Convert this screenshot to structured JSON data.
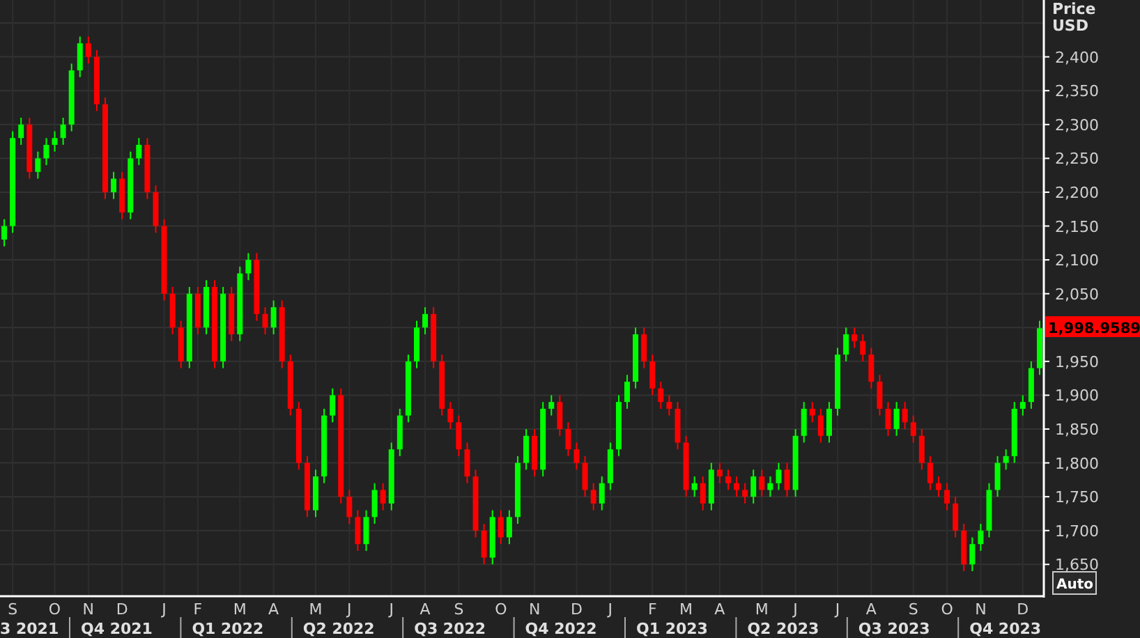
{
  "chart": {
    "price_axis": {
      "title": "Price",
      "unit": "USD"
    },
    "last_price": "1,998.9589",
    "scale_button": "Auto",
    "quarters": [
      "3 2021",
      "Q4 2021",
      "Q1 2022",
      "Q2 2022",
      "Q3 2022",
      "Q4 2022",
      "Q1 2023",
      "Q2 2023",
      "Q3 2023",
      "Q4 2023"
    ],
    "chart_data": {
      "type": "candlestick",
      "categories": [
        null,
        "S",
        null,
        null,
        null,
        null,
        "O",
        null,
        null,
        null,
        "N",
        null,
        null,
        null,
        "D",
        null,
        null,
        null,
        null,
        "J",
        null,
        null,
        null,
        "F",
        null,
        null,
        null,
        null,
        "M",
        null,
        null,
        null,
        "A",
        null,
        null,
        null,
        null,
        "M",
        null,
        null,
        null,
        "J",
        null,
        null,
        null,
        null,
        "J",
        null,
        null,
        null,
        "A",
        null,
        null,
        null,
        "S",
        null,
        null,
        null,
        null,
        "O",
        null,
        null,
        null,
        "N",
        null,
        null,
        null,
        null,
        "D",
        null,
        null,
        null,
        "J",
        null,
        null,
        null,
        null,
        "F",
        null,
        null,
        null,
        "M",
        null,
        null,
        null,
        "A",
        null,
        null,
        null,
        null,
        "M",
        null,
        null,
        null,
        "J",
        null,
        null,
        null,
        null,
        "J",
        null,
        null,
        null,
        "A",
        null,
        null,
        null,
        null,
        "S",
        null,
        null,
        null,
        "O",
        null,
        null,
        null,
        "N",
        null,
        null,
        null,
        null,
        "D",
        null,
        null
      ],
      "ohlc": [
        [
          2130,
          2160,
          2120,
          2150
        ],
        [
          2150,
          2290,
          2140,
          2280
        ],
        [
          2280,
          2310,
          2270,
          2300
        ],
        [
          2300,
          2310,
          2220,
          2230
        ],
        [
          2230,
          2260,
          2220,
          2250
        ],
        [
          2250,
          2280,
          2240,
          2270
        ],
        [
          2270,
          2290,
          2260,
          2280
        ],
        [
          2280,
          2310,
          2270,
          2300
        ],
        [
          2300,
          2390,
          2290,
          2380
        ],
        [
          2380,
          2430,
          2370,
          2420
        ],
        [
          2420,
          2430,
          2390,
          2400
        ],
        [
          2400,
          2410,
          2320,
          2330
        ],
        [
          2330,
          2340,
          2190,
          2200
        ],
        [
          2200,
          2230,
          2190,
          2220
        ],
        [
          2220,
          2230,
          2160,
          2170
        ],
        [
          2170,
          2260,
          2160,
          2250
        ],
        [
          2250,
          2280,
          2240,
          2270
        ],
        [
          2270,
          2280,
          2190,
          2200
        ],
        [
          2200,
          2210,
          2140,
          2150
        ],
        [
          2150,
          2160,
          2040,
          2050
        ],
        [
          2050,
          2060,
          1990,
          2000
        ],
        [
          2000,
          2010,
          1940,
          1950
        ],
        [
          1950,
          2060,
          1940,
          2050
        ],
        [
          2050,
          2060,
          1990,
          2000
        ],
        [
          2000,
          2070,
          1990,
          2060
        ],
        [
          2060,
          2070,
          1940,
          1950
        ],
        [
          1950,
          2060,
          1940,
          2050
        ],
        [
          2050,
          2060,
          1980,
          1990
        ],
        [
          1990,
          2090,
          1980,
          2080
        ],
        [
          2080,
          2110,
          2070,
          2100
        ],
        [
          2100,
          2110,
          2010,
          2020
        ],
        [
          2020,
          2030,
          1990,
          2000
        ],
        [
          2000,
          2040,
          1990,
          2030
        ],
        [
          2030,
          2040,
          1940,
          1950
        ],
        [
          1950,
          1960,
          1870,
          1880
        ],
        [
          1880,
          1890,
          1790,
          1800
        ],
        [
          1800,
          1810,
          1720,
          1730
        ],
        [
          1730,
          1790,
          1720,
          1780
        ],
        [
          1780,
          1880,
          1770,
          1870
        ],
        [
          1870,
          1910,
          1860,
          1900
        ],
        [
          1900,
          1910,
          1740,
          1750
        ],
        [
          1750,
          1760,
          1710,
          1720
        ],
        [
          1720,
          1730,
          1670,
          1680
        ],
        [
          1680,
          1730,
          1670,
          1720
        ],
        [
          1720,
          1770,
          1710,
          1760
        ],
        [
          1760,
          1770,
          1730,
          1740
        ],
        [
          1740,
          1830,
          1730,
          1820
        ],
        [
          1820,
          1880,
          1810,
          1870
        ],
        [
          1870,
          1960,
          1860,
          1950
        ],
        [
          1950,
          2010,
          1940,
          2000
        ],
        [
          2000,
          2030,
          1990,
          2020
        ],
        [
          2020,
          2030,
          1940,
          1950
        ],
        [
          1950,
          1960,
          1870,
          1880
        ],
        [
          1880,
          1890,
          1850,
          1860
        ],
        [
          1860,
          1870,
          1810,
          1820
        ],
        [
          1820,
          1830,
          1770,
          1780
        ],
        [
          1780,
          1790,
          1690,
          1700
        ],
        [
          1700,
          1710,
          1650,
          1660
        ],
        [
          1660,
          1730,
          1650,
          1720
        ],
        [
          1720,
          1730,
          1680,
          1690
        ],
        [
          1690,
          1730,
          1680,
          1720
        ],
        [
          1720,
          1810,
          1710,
          1800
        ],
        [
          1800,
          1850,
          1790,
          1840
        ],
        [
          1840,
          1850,
          1780,
          1790
        ],
        [
          1790,
          1890,
          1780,
          1880
        ],
        [
          1880,
          1900,
          1870,
          1890
        ],
        [
          1890,
          1900,
          1840,
          1850
        ],
        [
          1850,
          1860,
          1810,
          1820
        ],
        [
          1820,
          1830,
          1790,
          1800
        ],
        [
          1800,
          1810,
          1750,
          1760
        ],
        [
          1760,
          1770,
          1730,
          1740
        ],
        [
          1740,
          1780,
          1730,
          1770
        ],
        [
          1770,
          1830,
          1760,
          1820
        ],
        [
          1820,
          1900,
          1810,
          1890
        ],
        [
          1890,
          1930,
          1880,
          1920
        ],
        [
          1920,
          2000,
          1910,
          1990
        ],
        [
          1990,
          2000,
          1940,
          1950
        ],
        [
          1950,
          1960,
          1900,
          1910
        ],
        [
          1910,
          1920,
          1880,
          1890
        ],
        [
          1890,
          1900,
          1870,
          1880
        ],
        [
          1880,
          1890,
          1820,
          1830
        ],
        [
          1830,
          1840,
          1750,
          1760
        ],
        [
          1760,
          1780,
          1750,
          1770
        ],
        [
          1770,
          1780,
          1730,
          1740
        ],
        [
          1740,
          1800,
          1730,
          1790
        ],
        [
          1790,
          1800,
          1770,
          1780
        ],
        [
          1780,
          1790,
          1760,
          1770
        ],
        [
          1770,
          1780,
          1750,
          1760
        ],
        [
          1760,
          1770,
          1740,
          1750
        ],
        [
          1750,
          1790,
          1740,
          1780
        ],
        [
          1780,
          1790,
          1750,
          1760
        ],
        [
          1760,
          1780,
          1750,
          1770
        ],
        [
          1770,
          1800,
          1760,
          1790
        ],
        [
          1790,
          1800,
          1750,
          1760
        ],
        [
          1760,
          1850,
          1750,
          1840
        ],
        [
          1840,
          1890,
          1830,
          1880
        ],
        [
          1880,
          1890,
          1860,
          1870
        ],
        [
          1870,
          1880,
          1830,
          1840
        ],
        [
          1840,
          1890,
          1830,
          1880
        ],
        [
          1880,
          1970,
          1870,
          1960
        ],
        [
          1960,
          2000,
          1950,
          1990
        ],
        [
          1990,
          2000,
          1970,
          1980
        ],
        [
          1980,
          1990,
          1950,
          1960
        ],
        [
          1960,
          1970,
          1910,
          1920
        ],
        [
          1920,
          1930,
          1870,
          1880
        ],
        [
          1880,
          1890,
          1840,
          1850
        ],
        [
          1850,
          1890,
          1840,
          1880
        ],
        [
          1880,
          1890,
          1850,
          1860
        ],
        [
          1860,
          1870,
          1830,
          1840
        ],
        [
          1840,
          1850,
          1790,
          1800
        ],
        [
          1800,
          1810,
          1760,
          1770
        ],
        [
          1770,
          1780,
          1750,
          1760
        ],
        [
          1760,
          1770,
          1730,
          1740
        ],
        [
          1740,
          1750,
          1690,
          1700
        ],
        [
          1700,
          1710,
          1640,
          1650
        ],
        [
          1650,
          1690,
          1640,
          1680
        ],
        [
          1680,
          1710,
          1670,
          1700
        ],
        [
          1700,
          1770,
          1690,
          1760
        ],
        [
          1760,
          1810,
          1750,
          1800
        ],
        [
          1800,
          1820,
          1790,
          1810
        ],
        [
          1810,
          1890,
          1800,
          1880
        ],
        [
          1880,
          1900,
          1870,
          1890
        ],
        [
          1890,
          1950,
          1880,
          1940
        ],
        [
          1940,
          2010,
          1930,
          1999
        ]
      ],
      "ylim": [
        1603,
        2484
      ],
      "grid": true,
      "yticks": [
        {
          "value": 1650,
          "label": "1,650"
        },
        {
          "value": 1700,
          "label": "1,700"
        },
        {
          "value": 1750,
          "label": "1,750"
        },
        {
          "value": 1800,
          "label": "1,800"
        },
        {
          "value": 1850,
          "label": "1,850"
        },
        {
          "value": 1900,
          "label": "1,900"
        },
        {
          "value": 1950,
          "label": "1,950"
        },
        {
          "value": 2050,
          "label": "2,050"
        },
        {
          "value": 2100,
          "label": "2,100"
        },
        {
          "value": 2150,
          "label": "2,150"
        },
        {
          "value": 2200,
          "label": "2,200"
        },
        {
          "value": 2250,
          "label": "2,250"
        },
        {
          "value": 2300,
          "label": "2,300"
        },
        {
          "value": 2350,
          "label": "2,350"
        },
        {
          "value": 2400,
          "label": "2,400"
        }
      ]
    }
  }
}
